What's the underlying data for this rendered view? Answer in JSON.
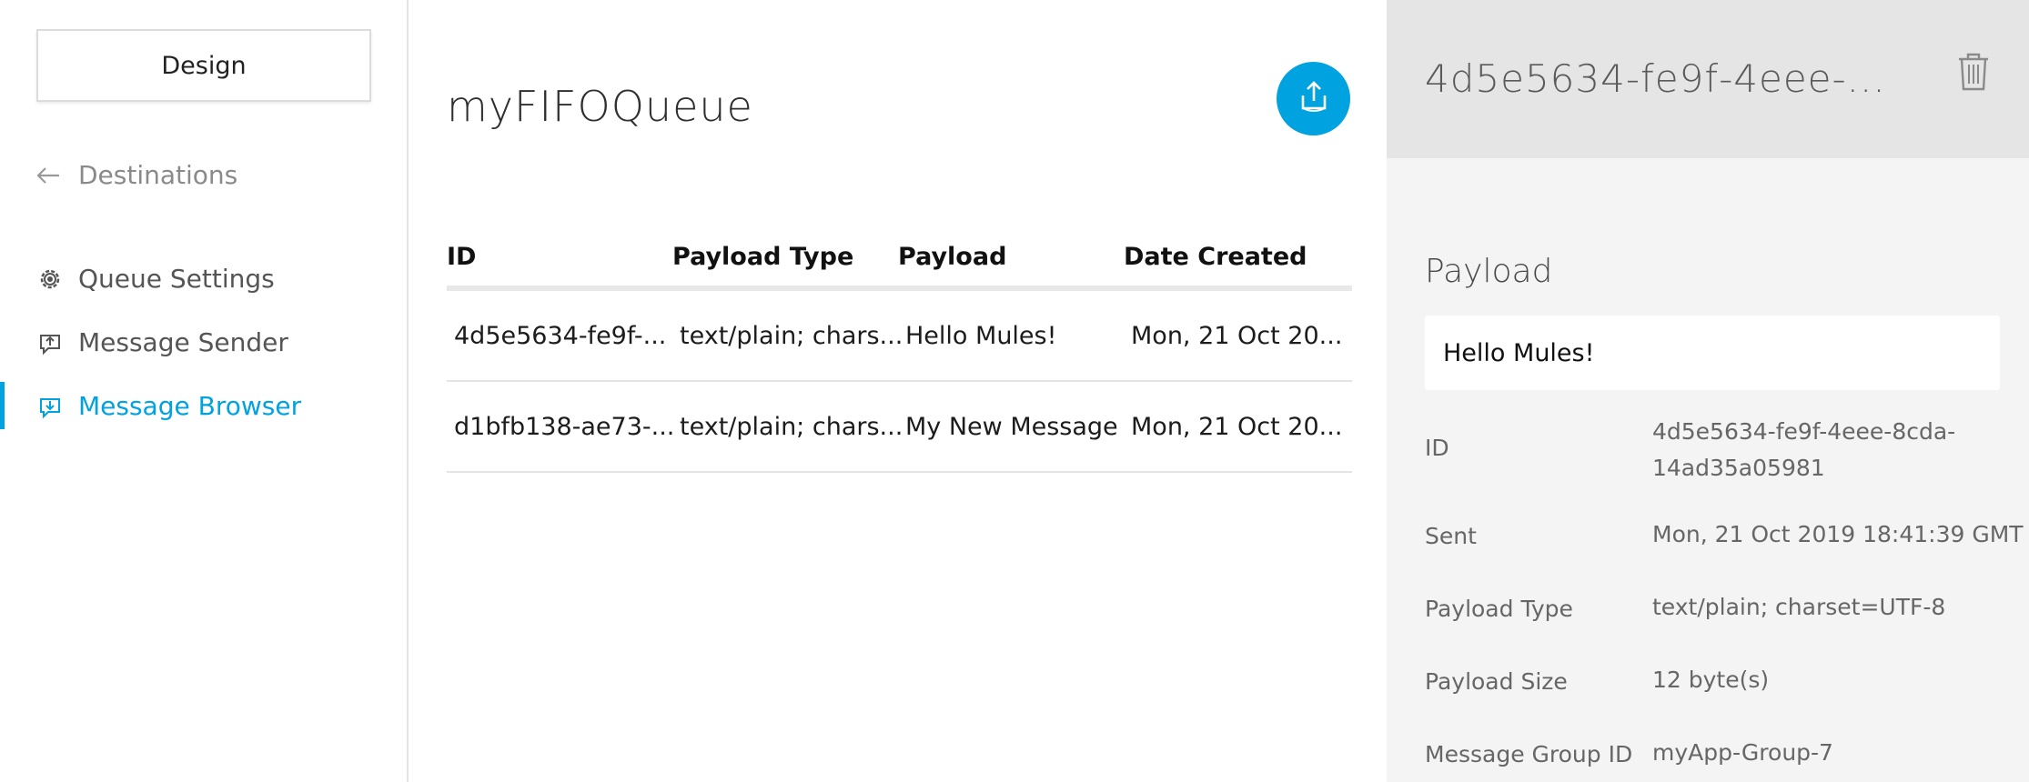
{
  "sidebar": {
    "design_label": "Design",
    "back_label": "Destinations",
    "items": [
      {
        "label": "Queue Settings",
        "icon": "gear-icon"
      },
      {
        "label": "Message Sender",
        "icon": "message-send-icon"
      },
      {
        "label": "Message Browser",
        "icon": "message-browse-icon",
        "active": true
      }
    ]
  },
  "main": {
    "title": "myFIFOQueue",
    "table": {
      "headers": [
        "ID",
        "Payload Type",
        "Payload",
        "Date Created"
      ],
      "rows": [
        [
          "4d5e5634-fe9f-...",
          "text/plain; chars...",
          "Hello Mules!",
          "Mon, 21 Oct 20..."
        ],
        [
          "d1bfb138-ae73-...",
          "text/plain; chars...",
          "My New Message",
          "Mon, 21 Oct 20..."
        ]
      ]
    }
  },
  "details": {
    "title": "4d5e5634-fe9f-4eee-...",
    "payload_label": "Payload",
    "payload_value": "Hello Mules!",
    "fields": [
      {
        "key": "ID",
        "value_line1": "4d5e5634-fe9f-4eee-8cda-",
        "value_line2": "14ad35a05981"
      },
      {
        "key": "Sent",
        "value": "Mon, 21 Oct 2019 18:41:39 GMT"
      },
      {
        "key": "Payload Type",
        "value": "text/plain; charset=UTF-8"
      },
      {
        "key": "Payload Size",
        "value": "12 byte(s)"
      },
      {
        "key": "Message Group ID",
        "value": "myApp-Group-7"
      }
    ]
  },
  "colors": {
    "accent": "#00a2df",
    "panel_bg": "#f4f4f4",
    "panel_header_bg": "#e5e5e6"
  }
}
